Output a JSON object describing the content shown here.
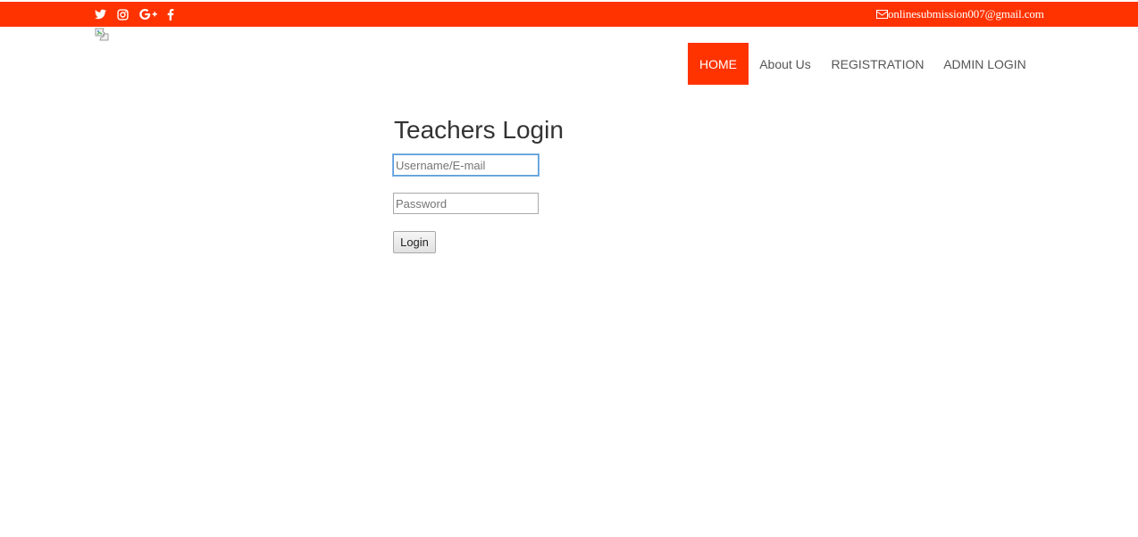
{
  "topbar": {
    "background": "#ff3300",
    "social_icons": [
      "twitter-icon",
      "instagram-icon",
      "google-plus-icon",
      "facebook-icon"
    ],
    "email_icon": "envelope-icon",
    "email": "onlinesubmission007@gmail.com"
  },
  "logo": {
    "icon": "broken-image-icon"
  },
  "nav": {
    "items": [
      {
        "label": "HOME",
        "active": true
      },
      {
        "label": "About Us",
        "active": false
      },
      {
        "label": "REGISTRATION",
        "active": false
      },
      {
        "label": "ADMIN LOGIN",
        "active": false
      }
    ],
    "active_color": "#ff3300"
  },
  "login": {
    "title": "Teachers Login",
    "username_placeholder": "Username/E-mail",
    "username_value": "",
    "password_placeholder": "Password",
    "password_value": "",
    "button_label": "Login"
  }
}
